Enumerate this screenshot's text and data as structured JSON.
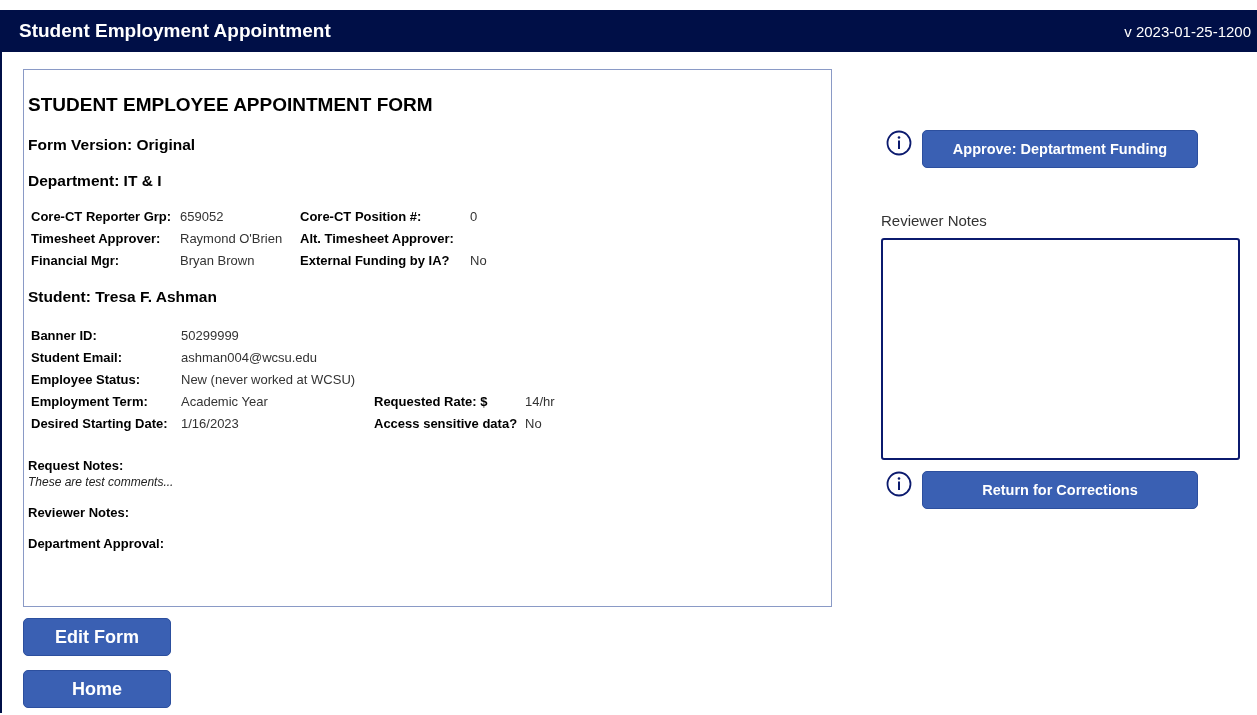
{
  "header": {
    "title": "Student Employment Appointment",
    "version": "v 2023-01-25-1200"
  },
  "form": {
    "title": "STUDENT EMPLOYEE APPOINTMENT FORM",
    "version_line": "Form Version: Original",
    "department_line": "Department: IT & I",
    "staff_rows": [
      {
        "fields": [
          {
            "label": "Core-CT Reporter Grp:",
            "value": "659052"
          },
          {
            "label": "Core-CT Position #:",
            "value": "0"
          }
        ]
      },
      {
        "fields": [
          {
            "label": "Timesheet Approver:",
            "value": "Raymond O'Brien"
          },
          {
            "label": "Alt. Timesheet Approver:"
          }
        ]
      },
      {
        "fields": [
          {
            "label": "Financial Mgr:",
            "value": "Bryan Brown"
          },
          {
            "label": "External Funding by IA?",
            "value": "No"
          }
        ]
      }
    ],
    "student_line": "Student: Tresa F. Ashman",
    "student_rows": [
      {
        "fields": [
          {
            "label": "Banner ID:",
            "value": "50299999"
          }
        ]
      },
      {
        "fields": [
          {
            "label": "Student Email:",
            "value": "ashman004@wcsu.edu"
          }
        ]
      },
      {
        "fields": [
          {
            "label": "Employee Status:",
            "value": "New (never worked at WCSU)"
          }
        ]
      },
      {
        "fields": [
          {
            "label": "Employment Term:",
            "value": "Academic Year"
          },
          {
            "label": "Requested Rate: $",
            "value": "14/hr"
          }
        ]
      },
      {
        "fields": [
          {
            "label": "Desired Starting Date:",
            "value": "1/16/2023"
          },
          {
            "label": "Access sensitive data?",
            "value": "No"
          }
        ]
      }
    ],
    "request_notes": {
      "label": "Request Notes:",
      "text": "These are test comments..."
    },
    "reviewer_notes_label": "Reviewer Notes:",
    "department_approval_label": "Department Approval:"
  },
  "left_buttons": [
    "Edit Form",
    "Home"
  ],
  "review": {
    "approve_button": "Approve: Deptartment Funding",
    "notes_label": "Reviewer Notes",
    "return_button": "Return for Corrections"
  }
}
